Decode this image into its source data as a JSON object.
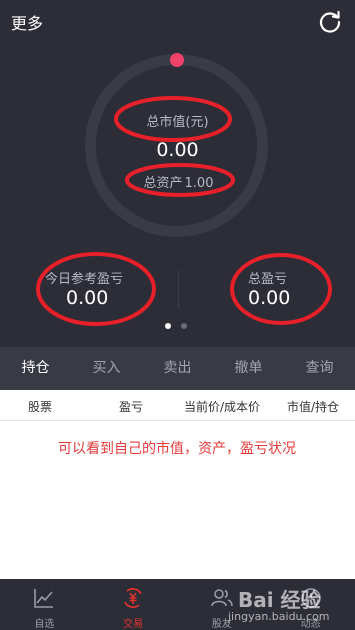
{
  "header": {
    "more_label": "更多"
  },
  "summary": {
    "market_value_label": "总市值(元)",
    "market_value": "0.00",
    "total_assets_label": "总资产",
    "total_assets": "1.00",
    "today_pnl_label": "今日参考盈亏",
    "today_pnl": "0.00",
    "total_pnl_label": "总盈亏",
    "total_pnl": "0.00",
    "page_indicator": {
      "count": 2,
      "active": 0
    }
  },
  "tabs": [
    {
      "label": "持仓",
      "active": true
    },
    {
      "label": "买入",
      "active": false
    },
    {
      "label": "卖出",
      "active": false
    },
    {
      "label": "撤单",
      "active": false
    },
    {
      "label": "查询",
      "active": false
    }
  ],
  "columns": [
    "股票",
    "盈亏",
    "当前价/成本价",
    "市值/持仓"
  ],
  "annotation": "可以看到自己的市值，资产，盈亏状况",
  "bottom_nav": [
    {
      "label": "自选",
      "icon": "chart-line-icon",
      "active": false
    },
    {
      "label": "交易",
      "icon": "yuan-exchange-icon",
      "active": true
    },
    {
      "label": "股友",
      "icon": "friends-icon",
      "active": false
    },
    {
      "label": "动态",
      "icon": "activity-icon",
      "active": false
    }
  ],
  "watermark": {
    "main": "Bai 经验",
    "sub": "jingyan.baidu.com"
  },
  "colors": {
    "background_dark": "#2c2d36",
    "tab_bar": "#383a44",
    "accent_red": "#e5322b",
    "ring_dot": "#f0416a",
    "annotation_red": "#e53a3a"
  }
}
